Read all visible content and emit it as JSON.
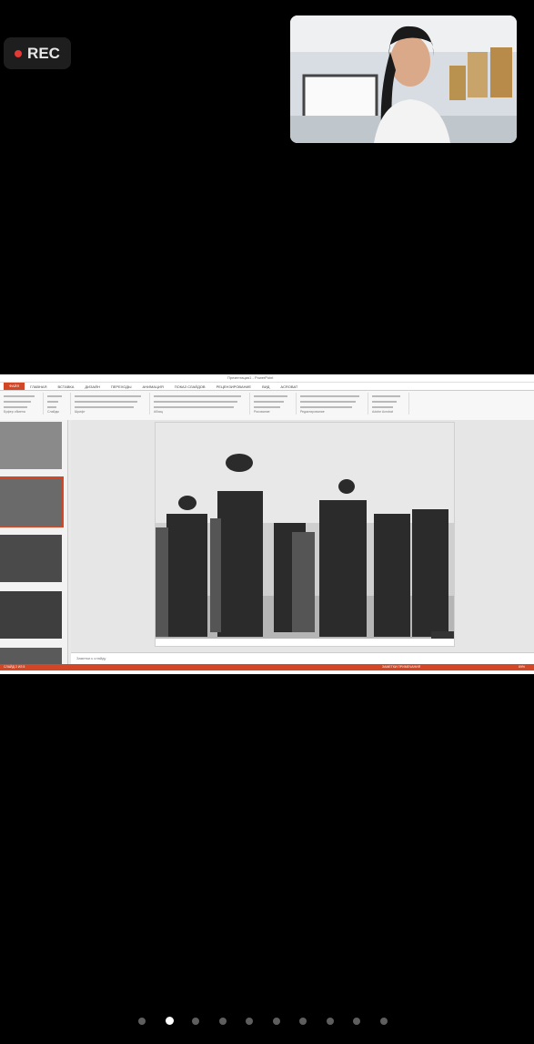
{
  "recording": {
    "label": "REC",
    "indicator_color": "#e53935"
  },
  "video_call": {
    "self_view": "participant-camera-feed"
  },
  "screen_share": {
    "window_title": "Презентация1 - PowerPoint",
    "ribbon_tabs": [
      "ФАЙЛ",
      "ГЛАВНАЯ",
      "ВСТАВКА",
      "ДИЗАЙН",
      "ПЕРЕХОДЫ",
      "АНИМАЦИЯ",
      "ПОКАЗ СЛАЙДОВ",
      "РЕЦЕНЗИРОВАНИЕ",
      "ВИД",
      "ACROBAT"
    ],
    "active_tab": "ФАЙЛ",
    "accent_color": "#d24726",
    "ribbon_groups": [
      "Буфер обмена",
      "Слайды",
      "Шрифт",
      "Абзац",
      "Рисование",
      "Редактирование",
      "Adobe Acrobat"
    ],
    "slide_thumbnails_count": 5,
    "selected_slide_index": 2,
    "notes_placeholder": "Заметки к слайду",
    "status_left": "СЛАЙД 2 ИЗ 5",
    "status_right": "ЗАМЕТКИ  ПРИМЕЧАНИЯ",
    "zoom": "69%",
    "slide_image_caption": "historical black-and-white photo of people walking in winter"
  },
  "pager": {
    "pages": 10,
    "active_index": 1
  }
}
